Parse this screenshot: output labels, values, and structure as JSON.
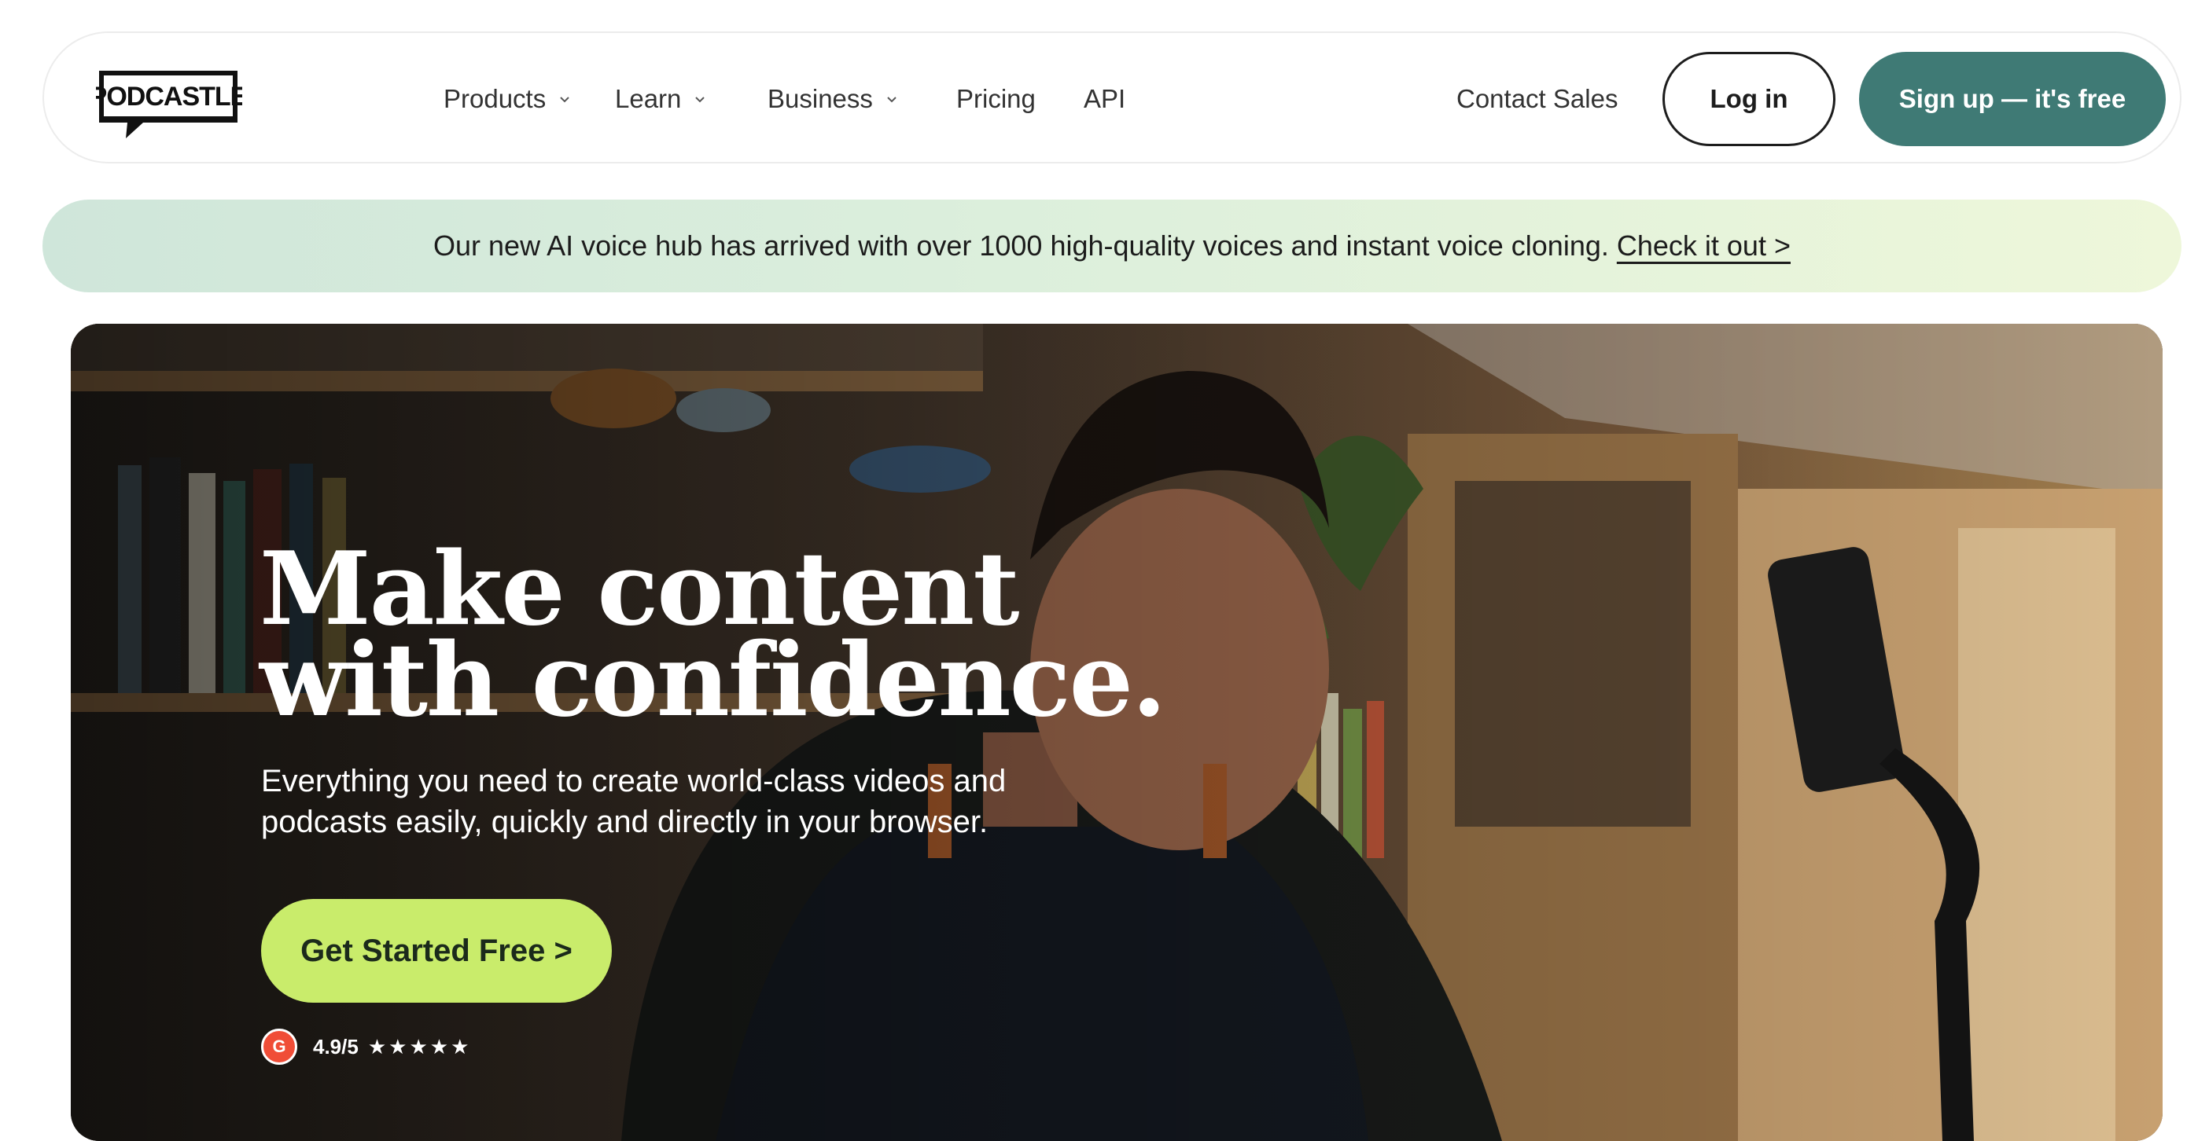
{
  "brand": {
    "logo_text": "PODCASTLE"
  },
  "nav": {
    "items": [
      {
        "label": "Products",
        "has_dropdown": true
      },
      {
        "label": "Learn",
        "has_dropdown": true
      },
      {
        "label": "Business",
        "has_dropdown": true
      },
      {
        "label": "Pricing",
        "has_dropdown": false
      },
      {
        "label": "API",
        "has_dropdown": false
      }
    ],
    "contact_sales": "Contact Sales",
    "login": "Log in",
    "signup": "Sign up — it's free"
  },
  "banner": {
    "text": "Our new AI voice hub has arrived with over 1000 high-quality voices and instant voice cloning.",
    "link": "Check it out >"
  },
  "hero": {
    "title_line1": "Make content",
    "title_line2": "with confidence.",
    "subtitle_line1": "Everything you need to create world-class videos and",
    "subtitle_line2": "podcasts easily, quickly and directly in your browser.",
    "cta": "Get Started Free >",
    "rating_badge": "G",
    "rating": "4.9/5",
    "stars": "★★★★★"
  },
  "colors": {
    "signup_bg": "#3f7a75",
    "cta_bg": "#c9ec6b",
    "banner_start": "#cfe6da",
    "banner_end": "#eef7da",
    "g2_red": "#f04d37"
  }
}
